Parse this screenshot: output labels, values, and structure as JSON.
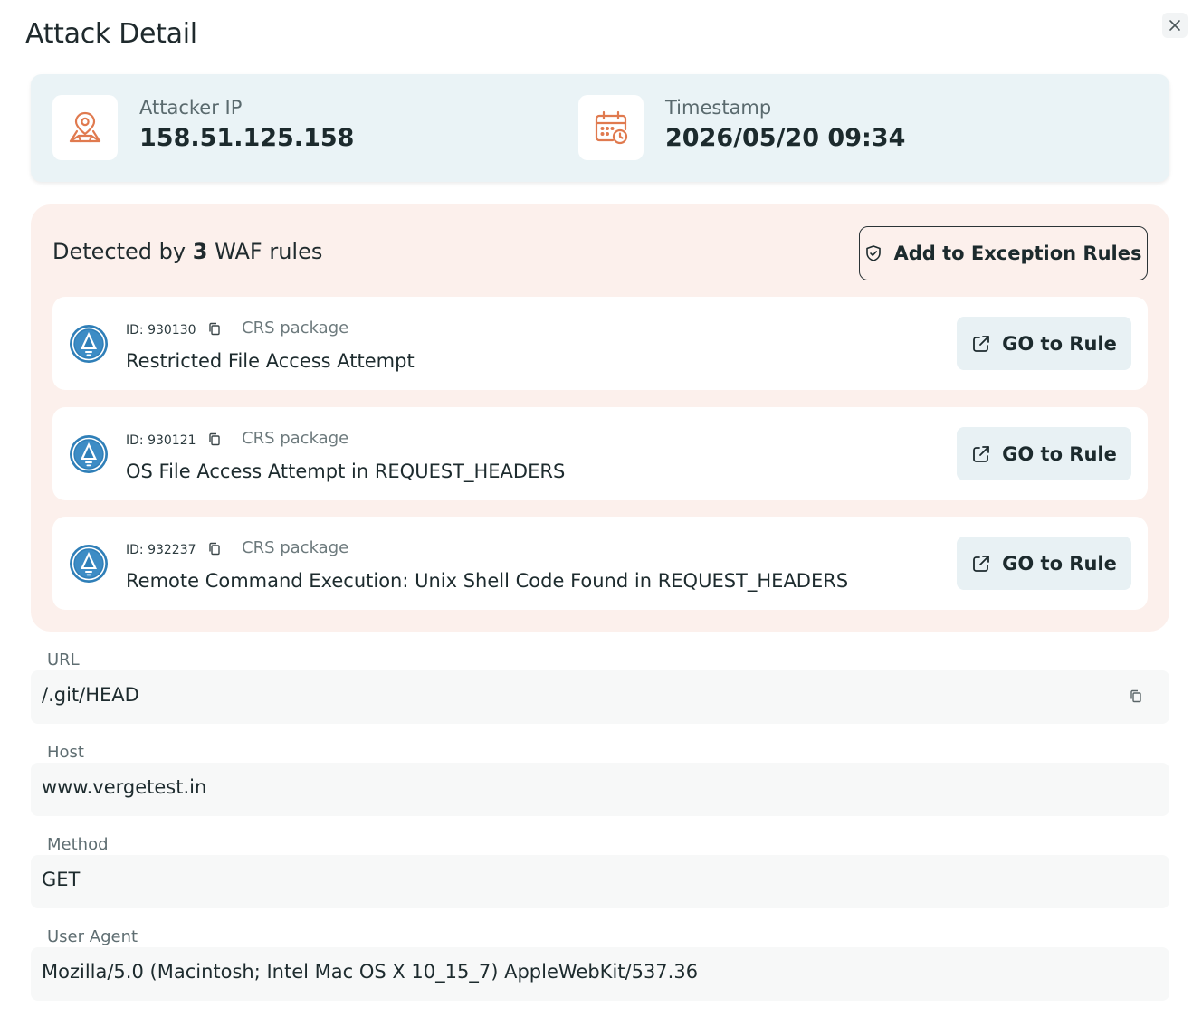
{
  "dialog": {
    "title": "Attack Detail"
  },
  "summary": {
    "attacker_ip_label": "Attacker IP",
    "attacker_ip": "158.51.125.158",
    "timestamp_label": "Timestamp",
    "timestamp": "2026/05/20 09:34"
  },
  "rules_panel": {
    "heading_prefix": "Detected by",
    "count": "3",
    "heading_suffix": "WAF rules",
    "exception_button": "Add to Exception Rules",
    "rules": [
      {
        "id": "ID: 930130",
        "package": "CRS package",
        "name": "Restricted File Access Attempt",
        "button": "GO to Rule"
      },
      {
        "id": "ID: 930121",
        "package": "CRS package",
        "name": "OS File Access Attempt in REQUEST_HEADERS",
        "button": "GO to Rule"
      },
      {
        "id": "ID: 932237",
        "package": "CRS package",
        "name": "Remote Command Execution: Unix Shell Code Found in REQUEST_HEADERS",
        "button": "GO to Rule"
      }
    ]
  },
  "fields": {
    "url_label": "URL",
    "url": "/.git/HEAD",
    "host_label": "Host",
    "host": "www.vergetest.in",
    "method_label": "Method",
    "method": "GET",
    "user_agent_label": "User Agent",
    "user_agent": "Mozilla/5.0 (Macintosh; Intel Mac OS X 10_15_7) AppleWebKit/537.36"
  },
  "icons": {
    "close": "close-icon",
    "location": "map-pin-icon",
    "calendar": "calendar-clock-icon",
    "shield": "shield-check-icon",
    "rule_logo": "crs-logo-icon",
    "copy": "copy-icon",
    "external": "external-link-icon"
  },
  "colors": {
    "accent_orange": "#e07a4f",
    "summary_bg": "#eaf3f6",
    "rules_bg": "#fcf0ec",
    "go_button_bg": "#e8f1f4",
    "logo_blue": "#2f7fb8"
  }
}
